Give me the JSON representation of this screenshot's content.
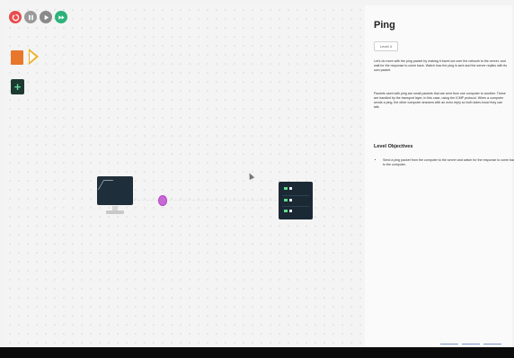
{
  "toolbar": {
    "buttons": [
      {
        "name": "reset",
        "color": "#e84c4c",
        "icon": "reset-icon"
      },
      {
        "name": "pause",
        "color": "#9a9a9a",
        "icon": "pause-icon"
      },
      {
        "name": "play",
        "color": "#8a8a8a",
        "icon": "play-icon"
      },
      {
        "name": "fast-forward",
        "color": "#2cb27a",
        "icon": "fast-forward-icon"
      }
    ]
  },
  "tools": {
    "packet_color": "#e8762b",
    "run_color": "#f0b01e",
    "add_glyph": "+"
  },
  "network": {
    "packet_color": "#c867d6",
    "server_led_color": "#5fe08b"
  },
  "panel": {
    "title": "Ping",
    "badge": "Level 4",
    "intro": "Let's do more with the ping packet by making it travel out over the network to the server, and wait for the response to come back. Watch how the ping is sent and the server replies with its own packet.",
    "body": "Packets used with ping are small packets that are sent from one computer to another. These are handled by the transport layer, in this case, using the ICMP protocol. When a computer sends a ping, the other computer answers with an echo reply so both sides know they can talk.",
    "subtitle": "Level Objectives",
    "objectives": [
      "Send a ping packet from the computer to the server and watch for the response to come back to the computer."
    ]
  }
}
